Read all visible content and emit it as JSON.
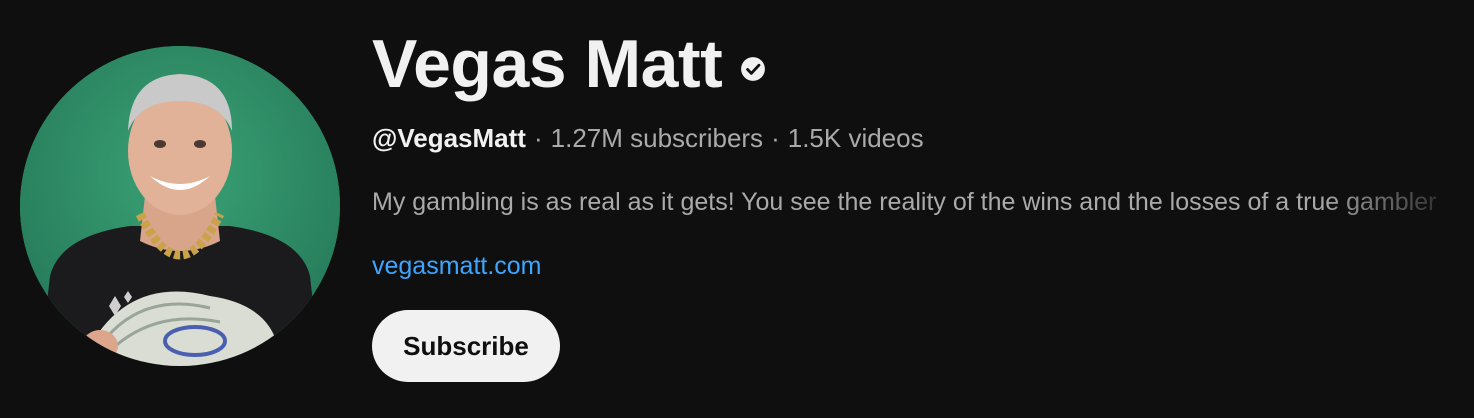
{
  "channel": {
    "name": "Vegas Matt",
    "verified_icon": "verified-check-icon",
    "handle": "@VegasMatt",
    "separator": "·",
    "subscribers": "1.27M subscribers",
    "videos": "1.5K videos",
    "description": "My gambling is as real as it gets! You see the reality of the wins and the losses of a true gambler",
    "link": "vegasmatt.com",
    "subscribe_label": "Subscribe"
  },
  "colors": {
    "background": "#0f0f0f",
    "primary_text": "#f1f1f1",
    "secondary_text": "#aaaaaa",
    "link": "#3ea6ff",
    "button_bg": "#f1f1f1",
    "avatar_bg": "#2f8f66"
  }
}
